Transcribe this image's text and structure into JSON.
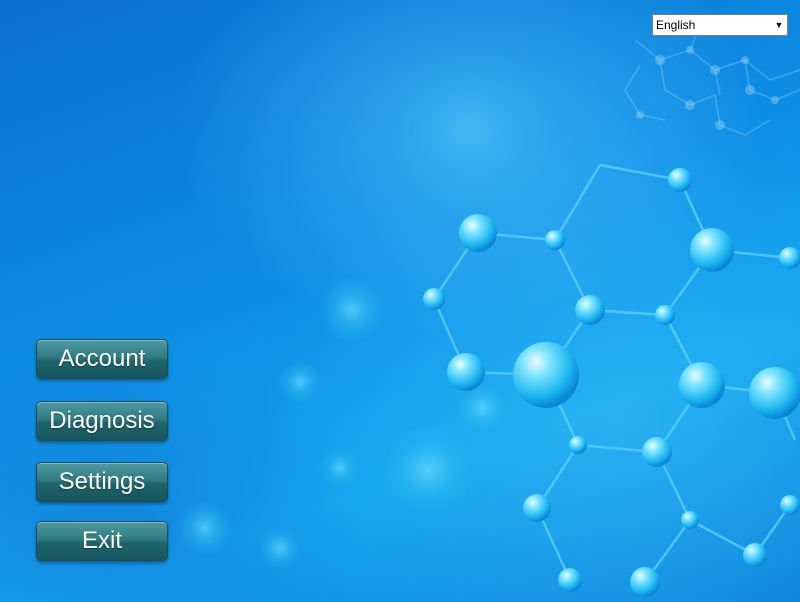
{
  "language_select": {
    "selected": "English"
  },
  "menu": {
    "account_label": "Account",
    "diagnosis_label": "Diagnosis",
    "settings_label": "Settings",
    "exit_label": "Exit"
  }
}
